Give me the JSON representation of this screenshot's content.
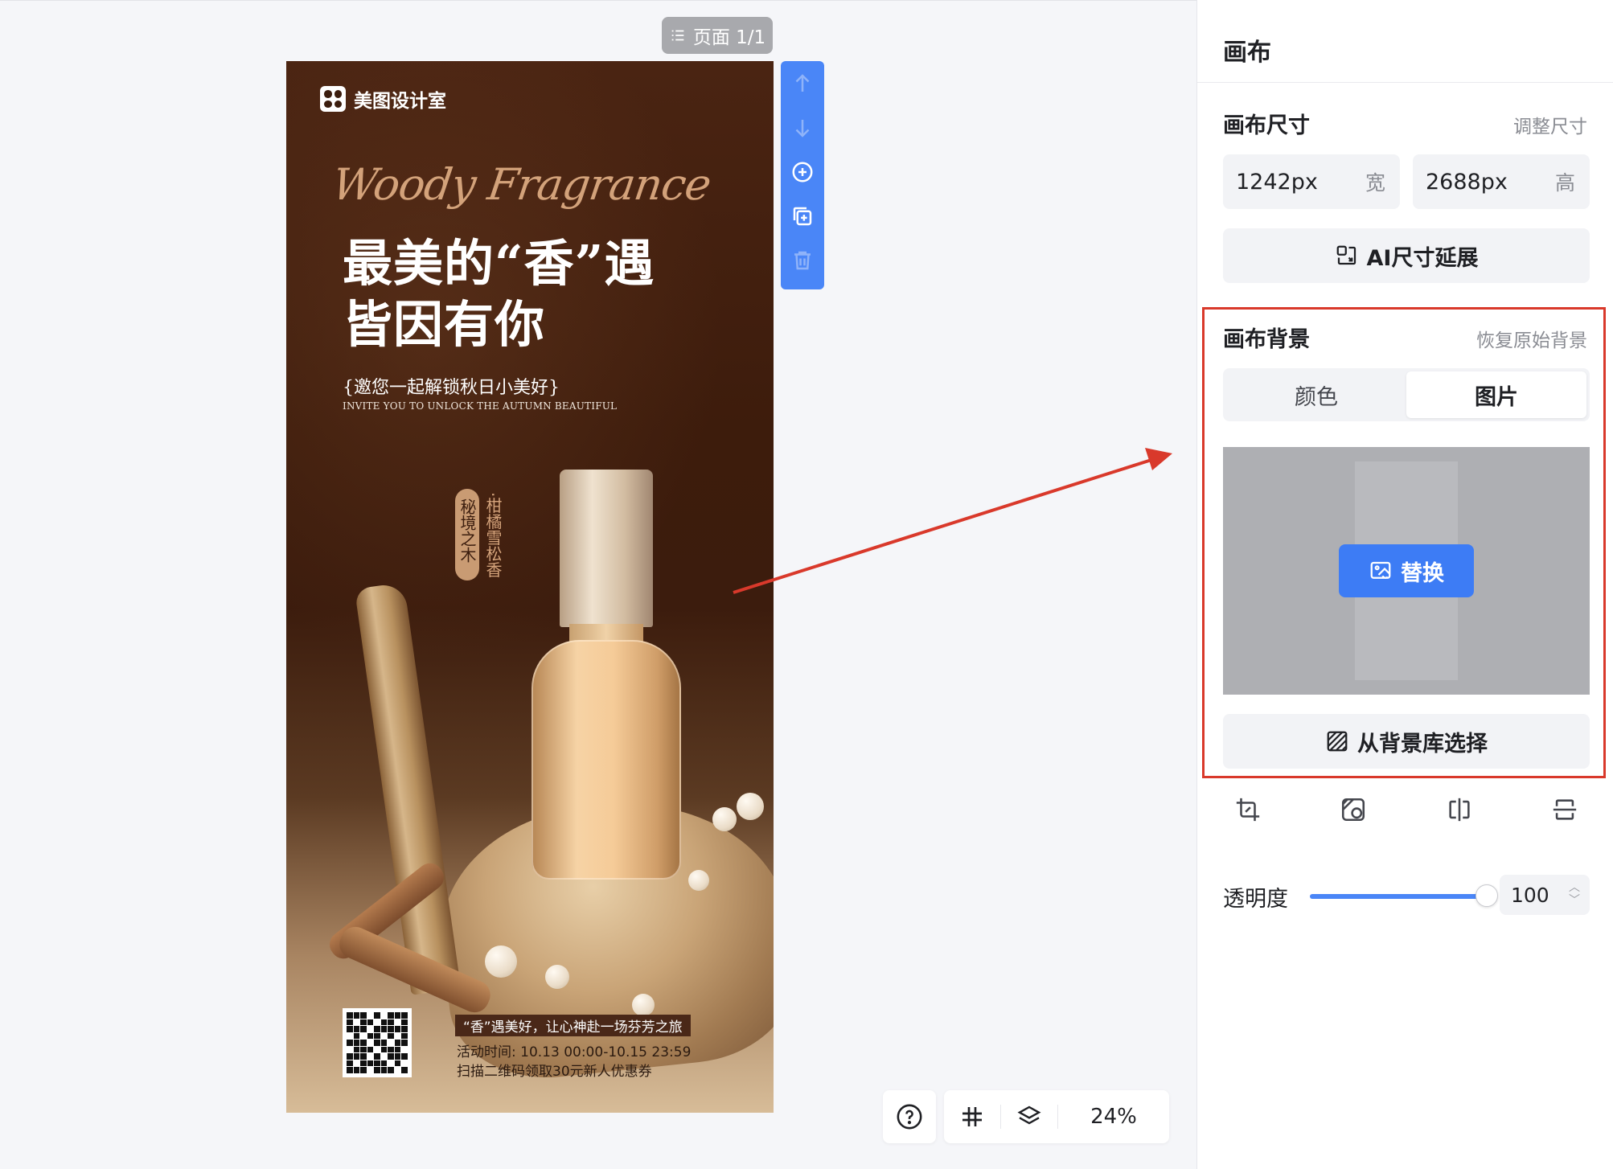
{
  "page_badge": {
    "label": "页面 1/1",
    "icon": "list-icon"
  },
  "poster": {
    "brand": "美图设计室",
    "script_title": "Woody Fragrance",
    "headline_line1": "最美的“香”遇",
    "headline_line2": "皆因有你",
    "subtitle_cn": "{邀您一起解锁秋日小美好}",
    "subtitle_en": "INVITE YOU TO UNLOCK THE AUTUMN BEAUTIFUL",
    "tag_pill": "秘境之木",
    "tag_vertical": "·柑橘雪松香",
    "promo_title": "“香”遇美好，让心神赴一场芬芳之旅",
    "promo_time": "活动时间: 10.13 00:00-10.15 23:59",
    "promo_coupon": "扫描二维码领取30元新人优惠券"
  },
  "side_tools": [
    "arrow-up-icon",
    "arrow-down-icon",
    "add-circle-icon",
    "duplicate-icon",
    "trash-icon"
  ],
  "bottom_bar": {
    "help_icon": "question-icon",
    "grid_icon": "grid-icon",
    "layers_icon": "layers-icon",
    "zoom": "24%"
  },
  "panel": {
    "title": "画布",
    "size_section": {
      "label": "画布尺寸",
      "link": "调整尺寸",
      "width_value": "1242px",
      "width_unit": "宽",
      "height_value": "2688px",
      "height_unit": "高",
      "ai_button": "AI尺寸延展"
    },
    "background_section": {
      "label": "画布背景",
      "link": "恢复原始背景",
      "tabs": [
        "颜色",
        "图片"
      ],
      "active_tab": "图片",
      "replace_button": "替换",
      "library_button": "从背景库选择"
    },
    "image_tools": [
      "crop-icon",
      "image-adjust-icon",
      "flip-horizontal-icon",
      "flip-vertical-icon"
    ],
    "opacity": {
      "label": "透明度",
      "value": "100",
      "level": 1.0
    }
  },
  "colors": {
    "accent": "#4a86f7",
    "annotation": "#d9392b",
    "poster_bg": "#3d1c0c"
  }
}
